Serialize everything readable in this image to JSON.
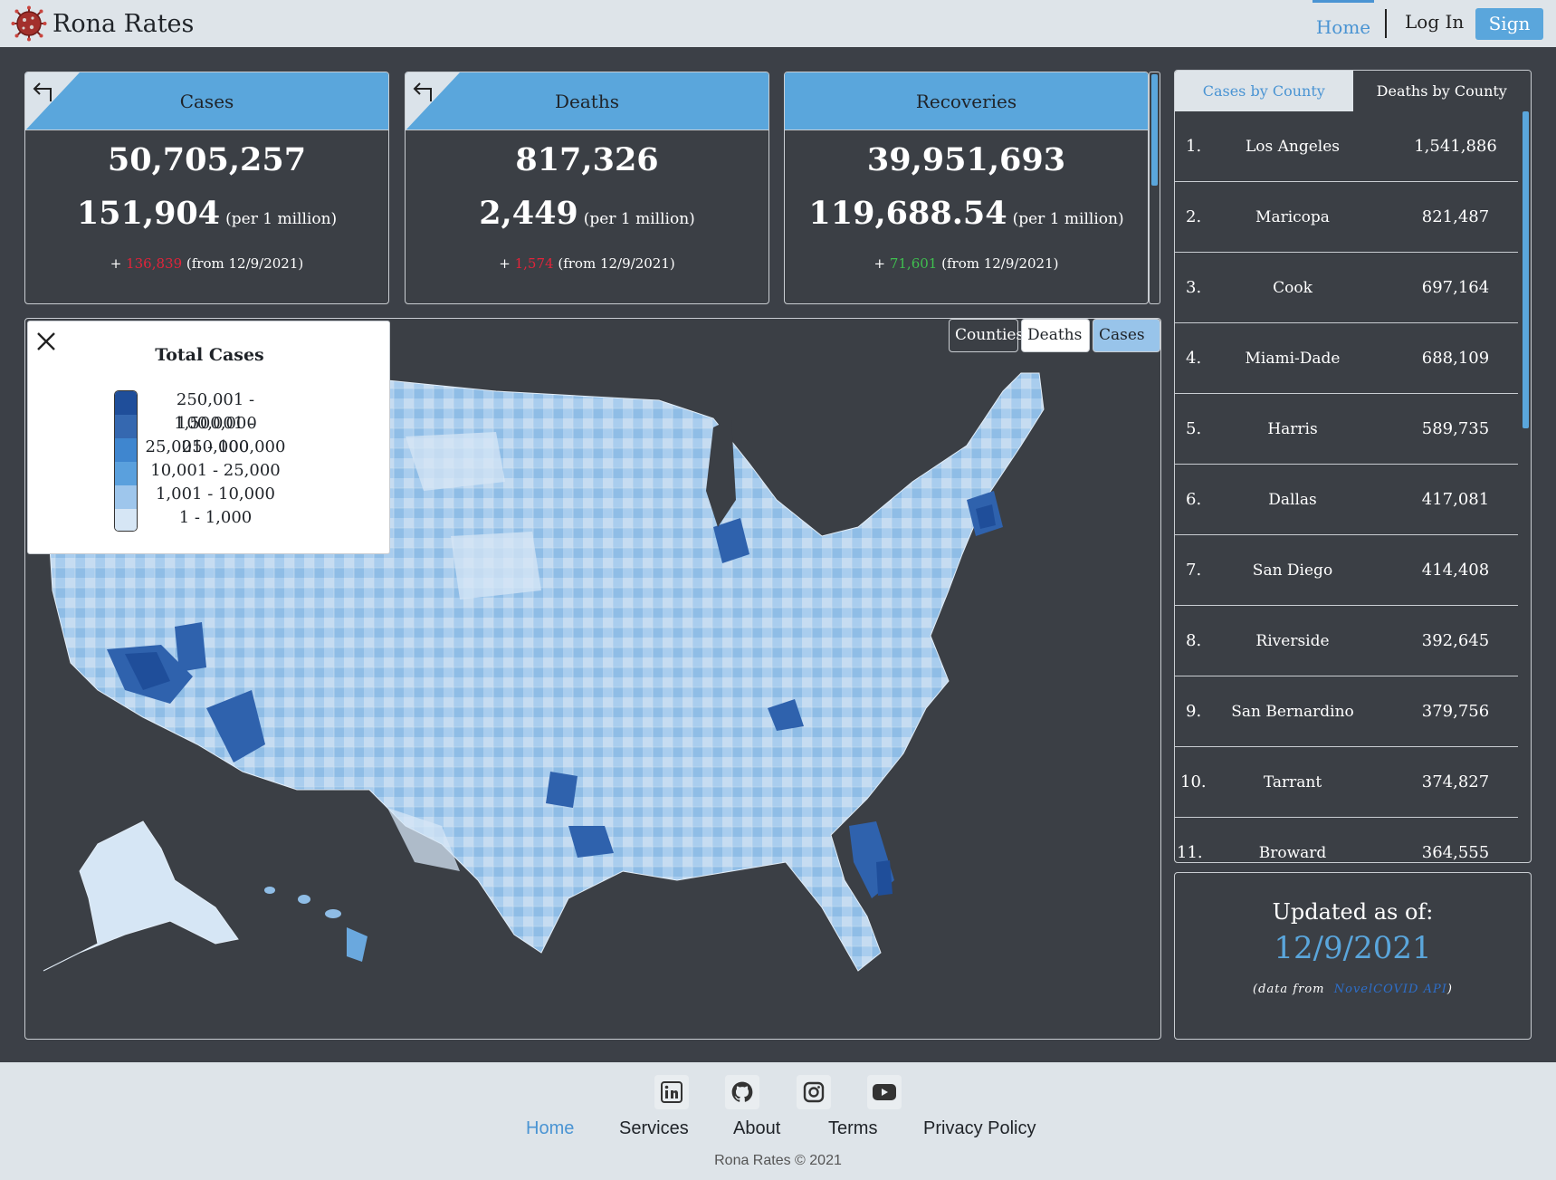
{
  "header": {
    "brand": "Rona Rates",
    "nav": {
      "home": "Home",
      "login": "Log In",
      "signup": "Sign Up"
    }
  },
  "stats": [
    {
      "title": "Cases",
      "total": "50,705,257",
      "per_million": "151,904",
      "per_million_label": "(per 1 million)",
      "change_prefix": "+",
      "change": "136,839",
      "change_suffix": "(from 12/9/2021)",
      "change_color": "#e0243a"
    },
    {
      "title": "Deaths",
      "total": "817,326",
      "per_million": "2,449",
      "per_million_label": "(per 1 million)",
      "change_prefix": "+",
      "change": "1,574",
      "change_suffix": "(from 12/9/2021)",
      "change_color": "#e0243a"
    },
    {
      "title": "Recoveries",
      "total": "39,951,693",
      "per_million": "119,688.54",
      "per_million_label": "(per 1 million)",
      "change_prefix": "+",
      "change": "71,601",
      "change_suffix": "(from 12/9/2021)",
      "change_color": "#3fbf4f"
    }
  ],
  "map": {
    "buttons": {
      "counties": "Counties",
      "deaths": "Deaths",
      "cases": "Cases"
    },
    "legend": {
      "title": "Total Cases",
      "ranges": [
        "250,001 - 1,500,000",
        "100,001 - 250,000",
        "25,001 - 100,000",
        "10,001 - 25,000",
        "1,001 - 10,000",
        "1 - 1,000"
      ],
      "colors": [
        "#1f4e9a",
        "#3568b0",
        "#3f86cf",
        "#5aa0dd",
        "#9ec6ec",
        "#d6e6f5"
      ]
    }
  },
  "county_panel": {
    "tabs": {
      "cases": "Cases by County",
      "deaths": "Deaths by County"
    },
    "rows": [
      {
        "rank": "1.",
        "name": "Los Angeles",
        "value": "1,541,886"
      },
      {
        "rank": "2.",
        "name": "Maricopa",
        "value": "821,487"
      },
      {
        "rank": "3.",
        "name": "Cook",
        "value": "697,164"
      },
      {
        "rank": "4.",
        "name": "Miami-Dade",
        "value": "688,109"
      },
      {
        "rank": "5.",
        "name": "Harris",
        "value": "589,735"
      },
      {
        "rank": "6.",
        "name": "Dallas",
        "value": "417,081"
      },
      {
        "rank": "7.",
        "name": "San Diego",
        "value": "414,408"
      },
      {
        "rank": "8.",
        "name": "Riverside",
        "value": "392,645"
      },
      {
        "rank": "9.",
        "name": "San Bernardino",
        "value": "379,756"
      },
      {
        "rank": "10.",
        "name": "Tarrant",
        "value": "374,827"
      },
      {
        "rank": "11.",
        "name": "Broward",
        "value": "364,555"
      }
    ]
  },
  "updated": {
    "label": "Updated as of:",
    "date": "12/9/2021",
    "source_prefix": "(data from",
    "source_link": "NovelCOVID API",
    "source_suffix": ")"
  },
  "footer": {
    "social_icons": [
      "linkedin-icon",
      "github-icon",
      "instagram-icon",
      "youtube-icon"
    ],
    "links": {
      "home": "Home",
      "services": "Services",
      "about": "About",
      "terms": "Terms",
      "privacy": "Privacy Policy"
    },
    "copyright": "Rona Rates © 2021"
  }
}
